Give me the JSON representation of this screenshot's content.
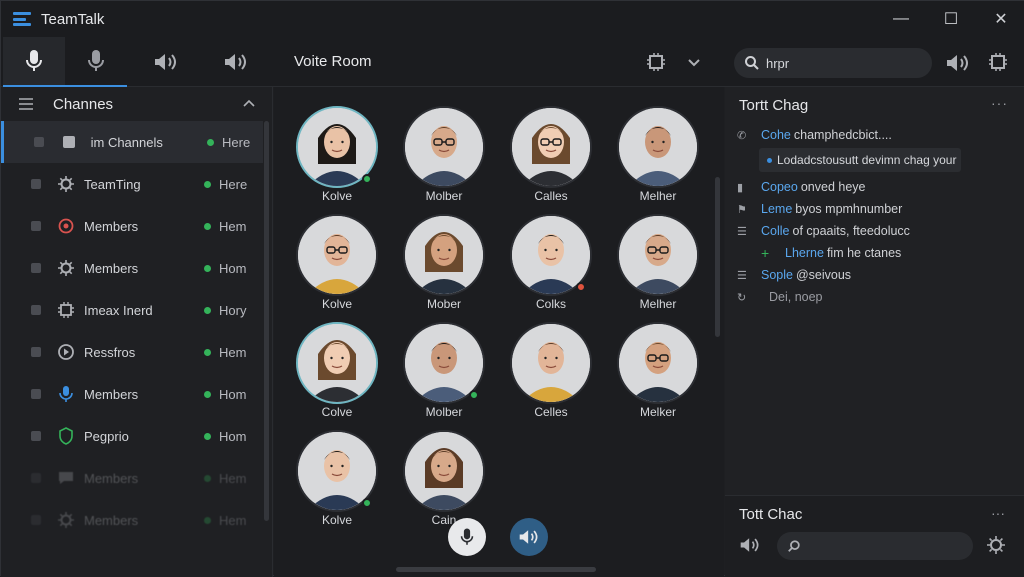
{
  "app": {
    "title": "TeamTalk"
  },
  "window_controls": {
    "minimize": "—",
    "maximize": "☐",
    "close": "✕"
  },
  "toolbar": {
    "buttons": [
      {
        "icon": "microphone-icon",
        "active": true
      },
      {
        "icon": "microphone-icon",
        "active": false
      },
      {
        "icon": "speaker-icon",
        "active": false
      },
      {
        "icon": "speaker-icon",
        "active": false
      }
    ],
    "room_title": "Voite Room",
    "search_value": "hrpr"
  },
  "sidebar": {
    "title": "Channes",
    "items": [
      {
        "label": " im Channels",
        "status": "Here",
        "icon": "checkbox-icon",
        "selected": true
      },
      {
        "label": "TeamTing",
        "status": "Here",
        "icon": "gear-icon"
      },
      {
        "label": "Members",
        "status": "Hem",
        "icon": "target-icon"
      },
      {
        "label": "Members",
        "status": "Hom",
        "icon": "gear-icon"
      },
      {
        "label": "Imeax Inerd",
        "status": "Hory",
        "icon": "chip-icon"
      },
      {
        "label": "Ressfros",
        "status": "Hem",
        "icon": "play-icon"
      },
      {
        "label": "Members",
        "status": "Hom",
        "icon": "microphone-icon"
      },
      {
        "label": "Pegprio",
        "status": "Hom",
        "icon": "shield-icon"
      },
      {
        "label": "Members",
        "status": "Hem",
        "icon": "chat-icon",
        "faded": true
      },
      {
        "label": "Members",
        "status": "Hem",
        "icon": "gear-icon",
        "faded": true
      }
    ]
  },
  "participants": [
    {
      "name": "Kolve",
      "presence": "green",
      "ring": true
    },
    {
      "name": "Molber",
      "presence": ""
    },
    {
      "name": "Calles",
      "presence": ""
    },
    {
      "name": "Melher",
      "presence": ""
    },
    {
      "name": "Kolve",
      "presence": ""
    },
    {
      "name": "Mober",
      "presence": ""
    },
    {
      "name": "Colks",
      "presence": "red"
    },
    {
      "name": "Melher",
      "presence": ""
    },
    {
      "name": "Colve",
      "presence": "",
      "ring": true
    },
    {
      "name": "Molber",
      "presence": "green"
    },
    {
      "name": "Celles",
      "presence": ""
    },
    {
      "name": "Melker",
      "presence": ""
    },
    {
      "name": "Kolve",
      "presence": "green"
    },
    {
      "name": "Cain",
      "presence": ""
    }
  ],
  "controls": {
    "mic": "microphone-icon",
    "speaker": "speaker-icon"
  },
  "chat": {
    "title": "Tortt Chag",
    "more": "···",
    "lines": [
      {
        "icon": "phone-icon",
        "who": "Cohe",
        "text": "champhedcbict...."
      },
      {
        "icon": "bars-icon",
        "who": "Copeo",
        "text": "onved heye"
      },
      {
        "icon": "flag-icon",
        "who": "Leme",
        "text": "byos mpmhnumber"
      },
      {
        "icon": "list-icon",
        "who": "Colle",
        "text": "of cpaaits, fteedolucc"
      },
      {
        "icon": "plus-icon",
        "who": "Lherne",
        "text": "fim he ctanes"
      },
      {
        "icon": "list-icon",
        "who": "Sople",
        "text": "@seivous"
      },
      {
        "icon": "refresh-icon",
        "who": "",
        "text": "Dei, noep"
      }
    ],
    "bubble": "Lodadcstousutt devimn chag your"
  },
  "chat_bottom": {
    "title": "Tott Chac",
    "more": "···"
  },
  "colors": {
    "accent": "#3b8fe0",
    "online": "#34b35a",
    "busy": "#e0533d"
  }
}
